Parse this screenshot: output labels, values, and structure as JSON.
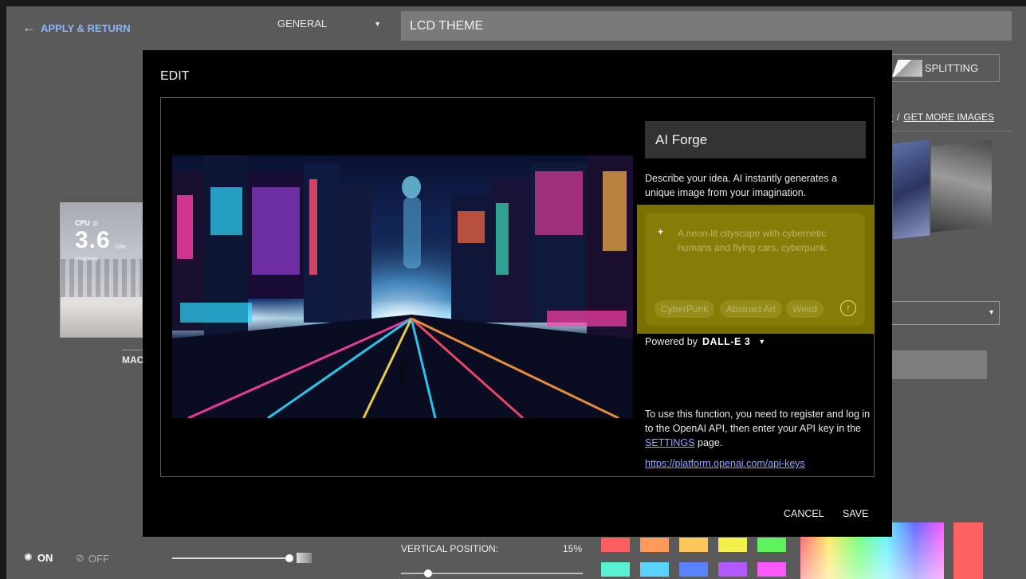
{
  "topbar": {
    "apply_label": "APPLY & RETURN",
    "category": "GENERAL",
    "theme_name": "LCD THEME"
  },
  "background": {
    "splitting_label": "SPLITTING",
    "link_partial": "P",
    "link_sep": "/",
    "get_more_label": "GET MORE IMAGES",
    "preview": {
      "cpu_label": "CPU",
      "value": "3.6",
      "unit": "Ghz",
      "metric": "Frequency",
      "caption": "MAC"
    },
    "on_label": "ON",
    "off_label": "OFF",
    "brightness_level": 1.0,
    "vertical_label": "VERTICAL POSITION:",
    "vertical_value": "15%",
    "vertical_level": 0.15,
    "swatches": [
      "#ff5f5f",
      "#ff9a5a",
      "#ffc75a",
      "#f2f04a",
      "#5ff25f",
      "#5af0d2",
      "#5ad2ff",
      "#5a82ff",
      "#b25aff",
      "#ff5aff"
    ],
    "hue_color": "#ff6060"
  },
  "modal": {
    "title": "EDIT",
    "forge_title": "AI Forge",
    "forge_desc": "Describe your idea. AI instantly generates a unique image from your imagination.",
    "prompt_placeholder": "A neon-lit cityscape with cybernetic humans and flying cars, cyberpunk.",
    "chips": [
      "CyberPunk",
      "Abstract Art",
      "Weird"
    ],
    "powered_by_label": "Powered by",
    "model": "DALL-E 3",
    "api_note_pre": "To use this function, you need to register and log in to the OpenAI API, then enter your API key in the",
    "settings_link": "SETTINGS",
    "api_note_post": "page.",
    "api_url": "https://platform.openai.com/api-keys",
    "cancel_label": "CANCEL",
    "save_label": "SAVE"
  },
  "colors": {
    "accent_link": "#8ea8ff",
    "prompt_highlight": "#7a7000"
  }
}
